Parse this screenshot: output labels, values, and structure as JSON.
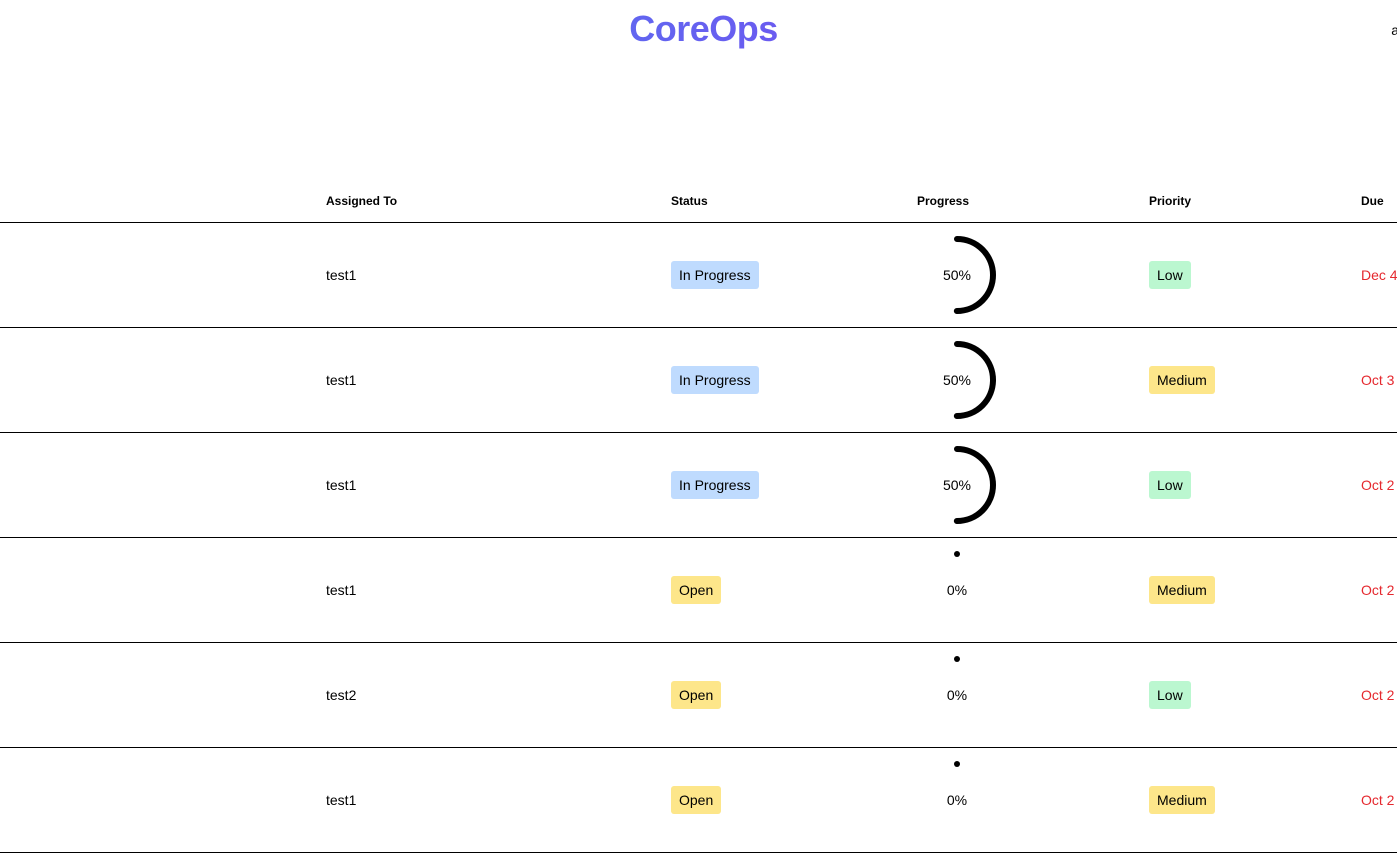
{
  "app": {
    "title": "CoreOps",
    "header_edge_text": "a"
  },
  "table": {
    "columns": {
      "assigned_to": "Assigned To",
      "status": "Status",
      "progress": "Progress",
      "priority": "Priority",
      "due": "Due"
    },
    "rows": [
      {
        "assigned_to": "test1",
        "status": "In Progress",
        "progress": 0.5,
        "progress_label": "50%",
        "priority": "Low",
        "due": "Dec 4"
      },
      {
        "assigned_to": "test1",
        "status": "In Progress",
        "progress": 0.5,
        "progress_label": "50%",
        "priority": "Medium",
        "due": "Oct 3"
      },
      {
        "assigned_to": "test1",
        "status": "In Progress",
        "progress": 0.5,
        "progress_label": "50%",
        "priority": "Low",
        "due": "Oct 2"
      },
      {
        "assigned_to": "test1",
        "status": "Open",
        "progress": 0.0,
        "progress_label": "0%",
        "priority": "Medium",
        "due": "Oct 2"
      },
      {
        "assigned_to": "test2",
        "status": "Open",
        "progress": 0.0,
        "progress_label": "0%",
        "priority": "Low",
        "due": "Oct 2"
      },
      {
        "assigned_to": "test1",
        "status": "Open",
        "progress": 0.0,
        "progress_label": "0%",
        "priority": "Medium",
        "due": "Oct 2"
      }
    ]
  },
  "colors": {
    "brand_gradient_start": "#3b8ff0",
    "brand_gradient_end": "#8b3cf0",
    "status_in_progress_bg": "#bfdbfe",
    "status_open_bg": "#fde68a",
    "priority_low_bg": "#bbf7d0",
    "priority_medium_bg": "#fde68a",
    "due_text": "#e5282e",
    "progress_stroke": "#000000"
  }
}
